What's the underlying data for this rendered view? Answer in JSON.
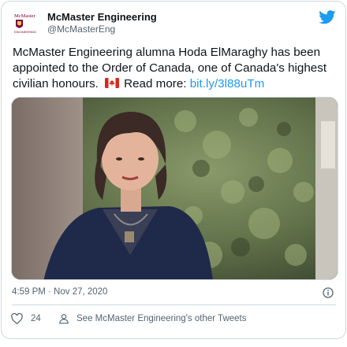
{
  "account": {
    "display_name": "McMaster Engineering",
    "handle": "@McMasterEng",
    "avatar_text": "McMaster ENGINEERING"
  },
  "tweet": {
    "text_main": "McMaster Engineering alumna Hoda ElMaraghy has been appointed to the Order of Canada, one of Canada's highest civilian honours.",
    "read_more": "Read more:",
    "link": "bit.ly/3l88uTm",
    "timestamp": "4:59 PM · Nov 27, 2020"
  },
  "actions": {
    "like_count": "24",
    "profile_link": "See McMaster Engineering's other Tweets"
  },
  "icons": {
    "brand": "twitter-bird-icon",
    "flag": "canada-flag-icon",
    "info": "info-icon",
    "like": "heart-icon",
    "profile": "person-icon"
  },
  "colors": {
    "link": "#1d9bf0",
    "brand": "#1d9bf0",
    "avatar_red": "#7a003c",
    "text": "#0f1419",
    "muted": "#536471"
  }
}
